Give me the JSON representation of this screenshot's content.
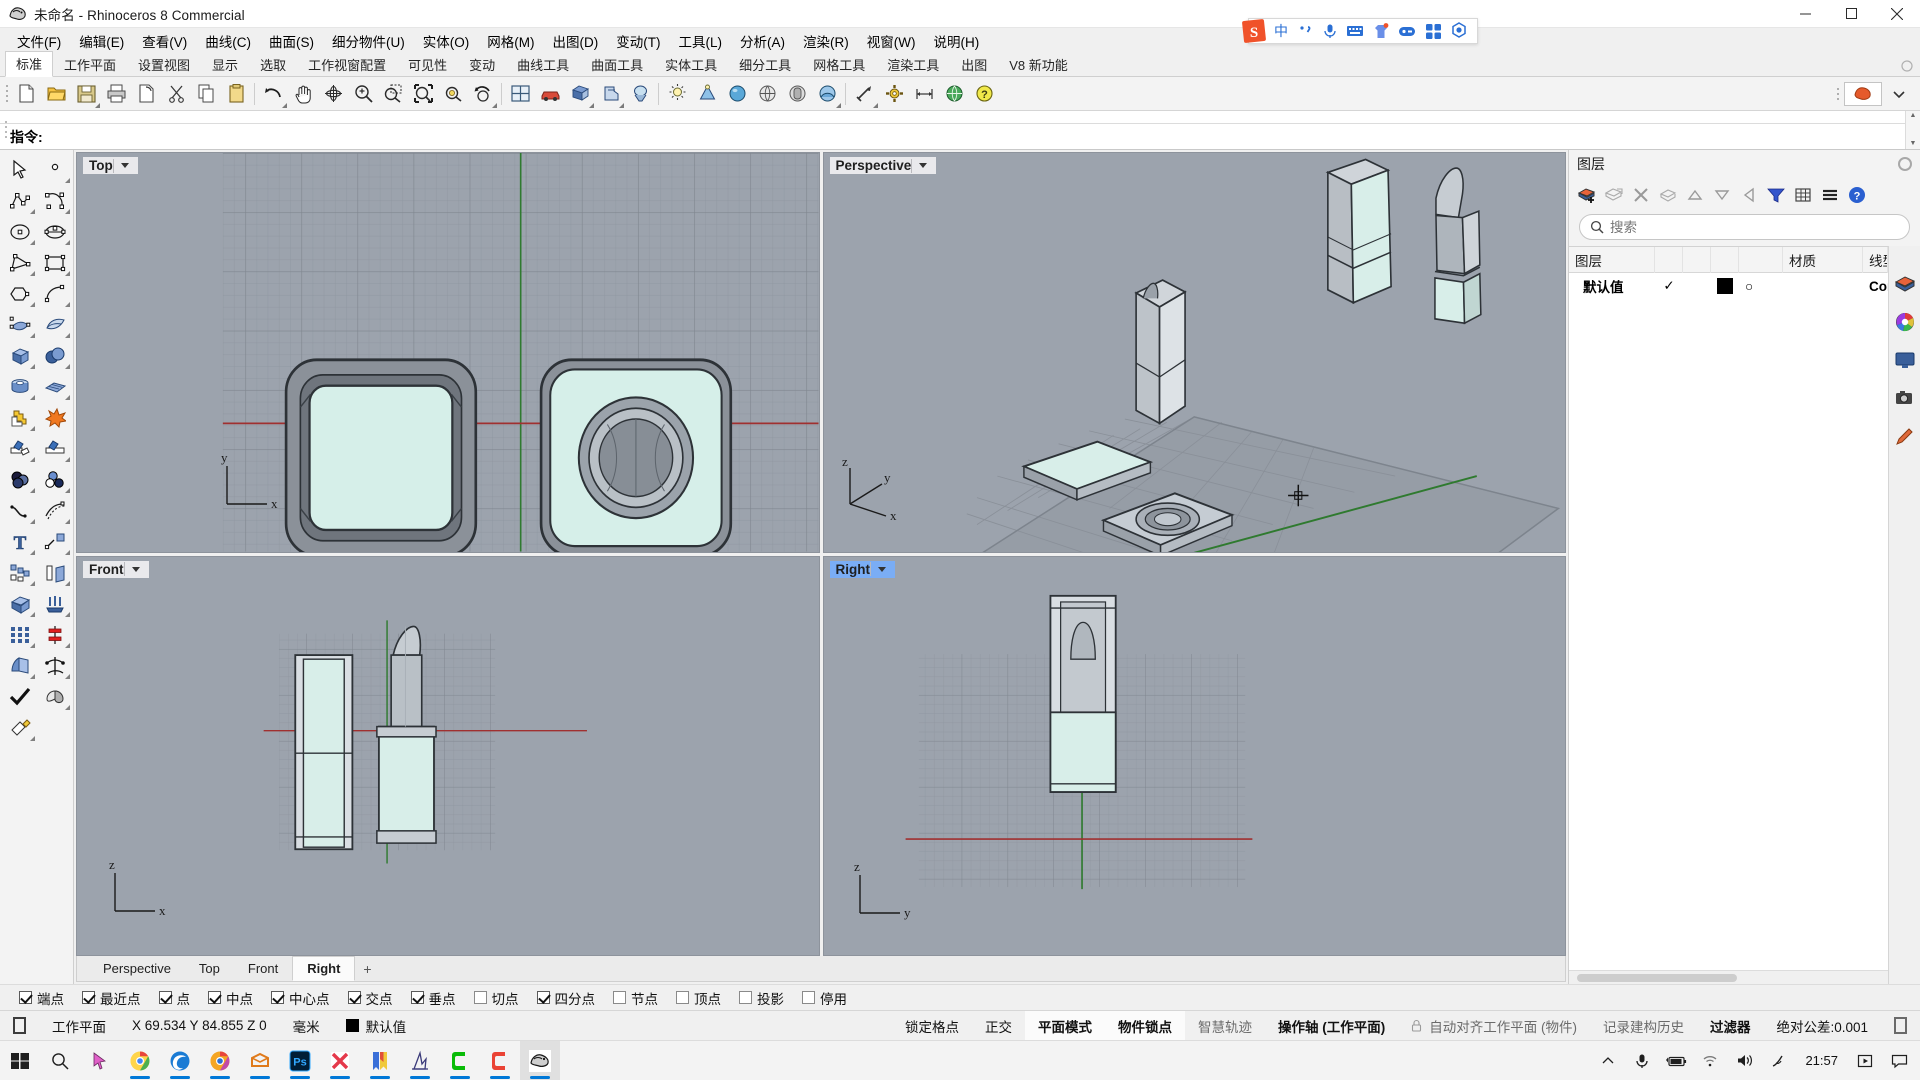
{
  "window": {
    "title": "未命名 - Rhinoceros 8 Commercial",
    "minimize": "—",
    "maximize": "▢",
    "close": "✕"
  },
  "menubar": {
    "items": [
      {
        "label": "文件(F)",
        "name": "menu-file"
      },
      {
        "label": "编辑(E)",
        "name": "menu-edit"
      },
      {
        "label": "查看(V)",
        "name": "menu-view"
      },
      {
        "label": "曲线(C)",
        "name": "menu-curve"
      },
      {
        "label": "曲面(S)",
        "name": "menu-surface"
      },
      {
        "label": "细分物件(U)",
        "name": "menu-subd"
      },
      {
        "label": "实体(O)",
        "name": "menu-solid"
      },
      {
        "label": "网格(M)",
        "name": "menu-mesh"
      },
      {
        "label": "出图(D)",
        "name": "menu-dimension"
      },
      {
        "label": "变动(T)",
        "name": "menu-transform"
      },
      {
        "label": "工具(L)",
        "name": "menu-tools"
      },
      {
        "label": "分析(A)",
        "name": "menu-analyze"
      },
      {
        "label": "渲染(R)",
        "name": "menu-render"
      },
      {
        "label": "视窗(W)",
        "name": "menu-window"
      },
      {
        "label": "说明(H)",
        "name": "menu-help"
      }
    ]
  },
  "toolbar_tabs": {
    "active": "标准",
    "items": [
      "标准",
      "工作平面",
      "设置视图",
      "显示",
      "选取",
      "工作视窗配置",
      "可见性",
      "变动",
      "曲线工具",
      "曲面工具",
      "实体工具",
      "细分工具",
      "网格工具",
      "渲染工具",
      "出图",
      "V8 新功能"
    ]
  },
  "icon_toolbar": {
    "icons": [
      "new-file-icon",
      "open-folder-icon",
      "save-icon",
      "print-icon",
      "copy-to-clipboard-icon",
      "cut-icon",
      "copy-icon",
      "paste-icon",
      "undo-icon",
      "pan-icon",
      "rotate-view-icon",
      "zoom-icon",
      "zoom-window-icon",
      "zoom-extents-icon",
      "zoom-selected-icon",
      "undo-view-icon",
      "four-view-icon",
      "render-icon",
      "shaded-view-icon",
      "ghosted-view-icon",
      "xray-view-icon",
      "light-icon",
      "spotlight-icon",
      "material-icon",
      "sphere-render-icon",
      "box-render-icon",
      "cylinder-render-icon",
      "render-preview-icon",
      "arrow-icon",
      "gear-icon",
      "dimension-icon",
      "globe-icon",
      "help-icon"
    ]
  },
  "command": {
    "prompt_label": "指令:",
    "value": "",
    "placeholder": ""
  },
  "side_tools": {
    "icons": [
      "select-arrow-icon",
      "point-icon",
      "polyline-icon",
      "curve-icon",
      "circle-icon",
      "ellipse-icon",
      "arc-icon",
      "rectangle-icon",
      "polygon-icon",
      "fillet-curve-icon",
      "surface-from-points-icon",
      "loft-surface-icon",
      "box-icon",
      "sphere-icon",
      "cylinder-icon",
      "surface-patch-icon",
      "boolean-union-icon",
      "explode-icon",
      "trim-icon",
      "split-icon",
      "boolean-difference-icon",
      "boolean-intersect-icon",
      "blend-curve-icon",
      "offset-curve-icon",
      "text-icon",
      "leader-icon",
      "array-icon",
      "mirror-icon",
      "cap-icon",
      "extrude-icon",
      "grid-array-icon",
      "dimension-linear-icon",
      "unroll-icon",
      "flow-along-curve-icon",
      "check-icon",
      "boolean-split-icon",
      "paint-icon"
    ]
  },
  "viewports": [
    {
      "name": "viewport-top",
      "label": "Top",
      "active": false
    },
    {
      "name": "viewport-perspective",
      "label": "Perspective",
      "active": false
    },
    {
      "name": "viewport-front",
      "label": "Front",
      "active": false
    },
    {
      "name": "viewport-right",
      "label": "Right",
      "active": true
    }
  ],
  "viewport_axes": {
    "top": {
      "v": "y",
      "h": "x"
    },
    "perspective": {
      "v": "z",
      "mid": "y",
      "h": "x"
    },
    "front": {
      "v": "z",
      "h": "x"
    },
    "right": {
      "v": "z",
      "h": "y"
    }
  },
  "viewport_tabs": {
    "active": "Right",
    "items": [
      "Perspective",
      "Top",
      "Front",
      "Right"
    ],
    "add_label": "+"
  },
  "layer_panel": {
    "title": "图层",
    "toolbar_icons": [
      "new-layer-icon",
      "new-sublayer-icon",
      "delete-layer-icon",
      "copy-layer-icon",
      "move-up-icon",
      "move-down-icon",
      "move-left-icon",
      "filter-icon",
      "grid-icon",
      "list-icon",
      "help-icon"
    ],
    "search_placeholder": "搜索",
    "search_value": "",
    "columns": [
      "图层",
      "",
      "",
      "",
      "",
      "材质",
      "线型"
    ],
    "rows": [
      {
        "name": "默认值",
        "on": "✓",
        "color": "#000000",
        "material": "○",
        "linetype": "Cor"
      }
    ]
  },
  "right_dock_icons": [
    "layers-icon",
    "color-wheel-icon",
    "display-icon",
    "camera-icon",
    "pen-icon"
  ],
  "osnap": {
    "items": [
      {
        "label": "端点",
        "checked": true
      },
      {
        "label": "最近点",
        "checked": true
      },
      {
        "label": "点",
        "checked": true
      },
      {
        "label": "中点",
        "checked": true
      },
      {
        "label": "中心点",
        "checked": true
      },
      {
        "label": "交点",
        "checked": true
      },
      {
        "label": "垂点",
        "checked": true
      },
      {
        "label": "切点",
        "checked": false
      },
      {
        "label": "四分点",
        "checked": true
      },
      {
        "label": "节点",
        "checked": false
      },
      {
        "label": "顶点",
        "checked": false
      },
      {
        "label": "投影",
        "checked": false
      },
      {
        "label": "停用",
        "checked": false
      }
    ]
  },
  "statusbar": {
    "cplane_icon": "cplane-icon",
    "cplane": "工作平面",
    "coords": "X 69.534 Y 84.855 Z 0",
    "units": "毫米",
    "layer_color": "#000000",
    "layer": "默认值",
    "toggles": [
      {
        "label": "锁定格点",
        "active": false,
        "bold": false
      },
      {
        "label": "正交",
        "active": false,
        "bold": false
      },
      {
        "label": "平面模式",
        "active": true,
        "bold": true
      },
      {
        "label": "物件锁点",
        "active": true,
        "bold": true
      },
      {
        "label": "智慧轨迹",
        "active": false,
        "bold": false,
        "dim": true
      },
      {
        "label": "操作轴 (工作平面)",
        "active": false,
        "bold": true
      },
      {
        "label": "自动对齐工作平面 (物件)",
        "active": false,
        "bold": false,
        "dim": true,
        "lock": true
      },
      {
        "label": "记录建构历史",
        "active": false,
        "bold": false,
        "dim": true
      },
      {
        "label": "过滤器",
        "active": false,
        "bold": true
      },
      {
        "label": "绝对公差:0.001",
        "active": false,
        "bold": false
      }
    ]
  },
  "ime_toolbar": {
    "icons": [
      "sogou-logo-icon",
      "chinese-mode-icon",
      "punctuation-icon",
      "microphone-icon",
      "keyboard-icon",
      "skin-icon",
      "emoji-icon",
      "apps-icon",
      "settings-icon"
    ]
  },
  "taskbar": {
    "apps": [
      {
        "name": "start-icon",
        "running": false,
        "active": false
      },
      {
        "name": "search-icon",
        "running": false,
        "active": false
      },
      {
        "name": "cursor-icon",
        "running": false,
        "active": false
      },
      {
        "name": "chrome-icon",
        "running": true,
        "active": false
      },
      {
        "name": "edge-icon",
        "running": true,
        "active": false
      },
      {
        "name": "chrome-beta-icon",
        "running": true,
        "active": false
      },
      {
        "name": "sketchup-icon",
        "running": true,
        "active": false
      },
      {
        "name": "photoshop-icon",
        "running": true,
        "active": false
      },
      {
        "name": "x-app-icon",
        "running": true,
        "active": false
      },
      {
        "name": "bookmark-icon",
        "running": true,
        "active": false
      },
      {
        "name": "keyshot-icon",
        "running": true,
        "active": false
      },
      {
        "name": "wechat-icon",
        "running": true,
        "active": false
      },
      {
        "name": "qq-icon",
        "running": true,
        "active": false
      },
      {
        "name": "rhino-icon",
        "running": true,
        "active": true
      }
    ],
    "tray": {
      "icons": [
        "chevron-up-icon",
        "microphone-icon",
        "battery-icon",
        "wifi-icon",
        "volume-icon",
        "pen-icon"
      ],
      "clock": "21:57",
      "right_icons": [
        "media-icon",
        "notifications-icon"
      ]
    }
  }
}
